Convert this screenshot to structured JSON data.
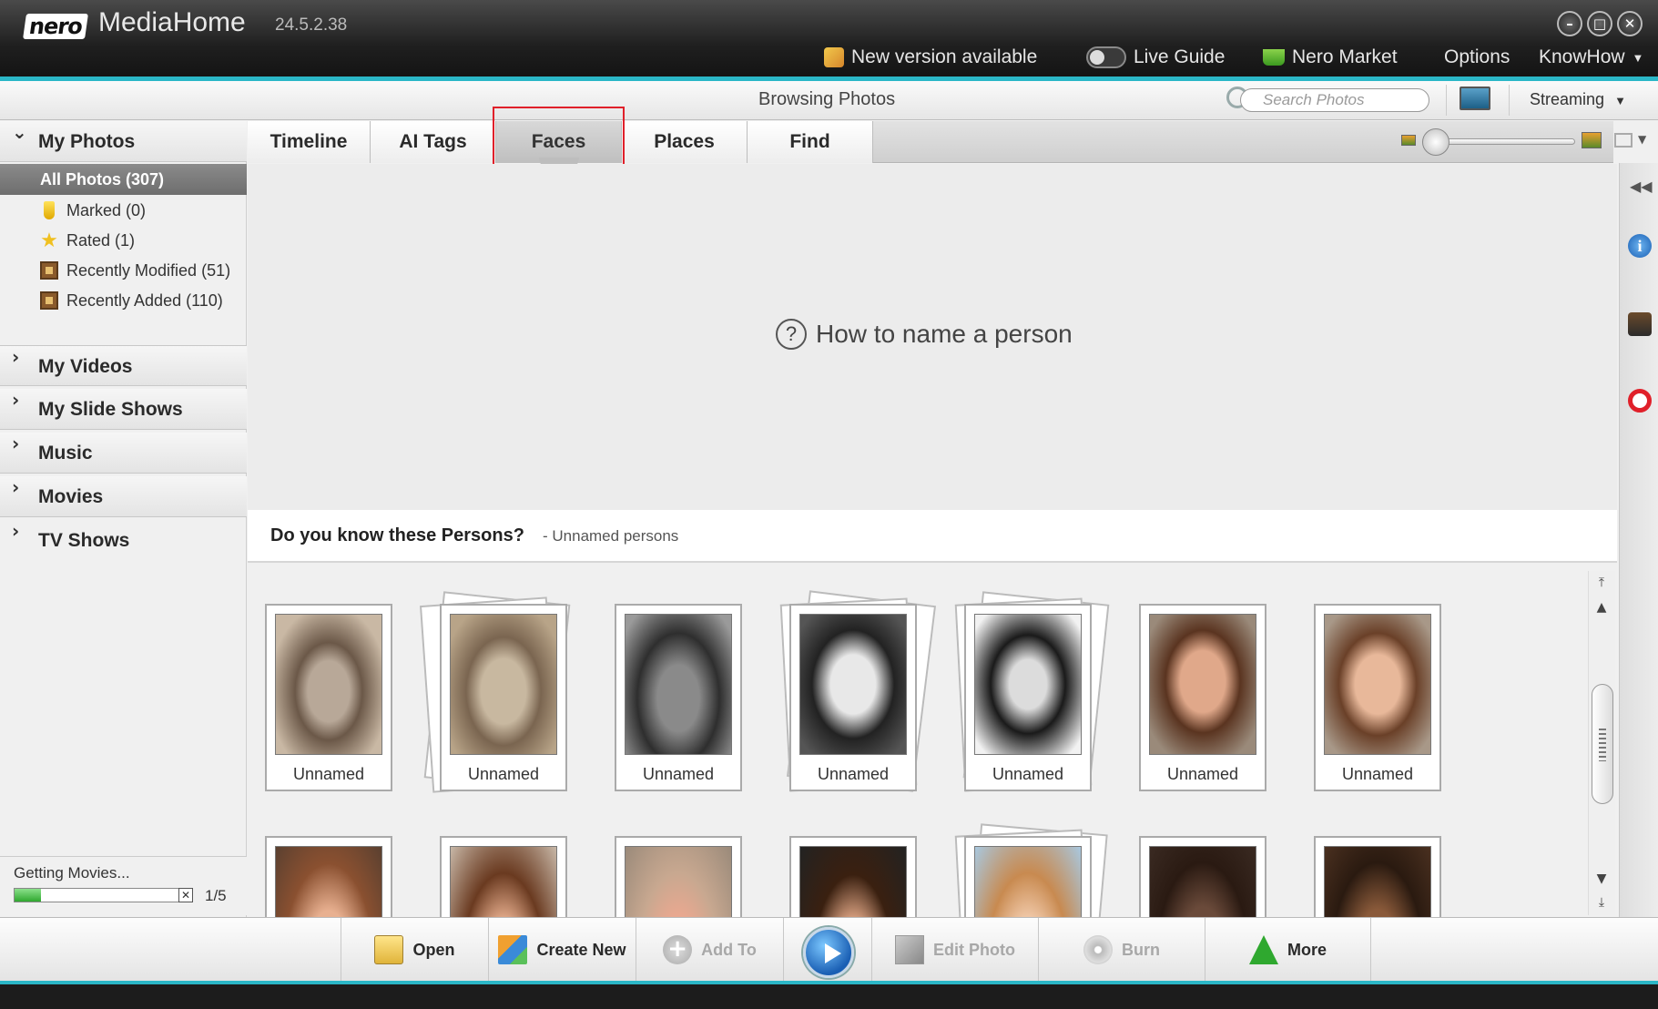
{
  "app": {
    "logo": "nero",
    "title": "MediaHome",
    "version": "24.5.2.38"
  },
  "window_buttons": {
    "minimize": "–",
    "maximize": "□",
    "close": "✕"
  },
  "topmenu": {
    "new_version": "New version available",
    "live_guide": "Live Guide",
    "nero_market": "Nero Market",
    "options": "Options",
    "knowhow": "KnowHow"
  },
  "subheader": {
    "browsing": "Browsing Photos",
    "search_placeholder": "Search Photos",
    "streaming": "Streaming"
  },
  "sidebar": {
    "my_photos": "My Photos",
    "all_photos": "All Photos (307)",
    "items": [
      {
        "label": "Marked (0)",
        "icon": "marked-icon"
      },
      {
        "label": "Rated (1)",
        "icon": "star-icon"
      },
      {
        "label": "Recently Modified (51)",
        "icon": "photo-frame-icon"
      },
      {
        "label": "Recently Added (110)",
        "icon": "photo-frame-icon"
      }
    ],
    "sections": [
      "My Videos",
      "My Slide Shows",
      "Music",
      "Movies",
      "TV Shows"
    ],
    "status": {
      "text": "Getting Movies...",
      "count": "1/5",
      "progress": 0.15
    }
  },
  "tabs": [
    "Timeline",
    "AI Tags",
    "Faces",
    "Places",
    "Find"
  ],
  "active_tab": "Faces",
  "hint": "How to name a person",
  "persons": {
    "title": "Do you know these Persons?",
    "subtitle": "- Unnamed persons",
    "row1": [
      "Unnamed",
      "Unnamed",
      "Unnamed",
      "Unnamed",
      "Unnamed",
      "Unnamed",
      "Unnamed"
    ]
  },
  "toolbar": {
    "open": "Open",
    "create_new": "Create New",
    "add_to": "Add To",
    "edit_photo": "Edit Photo",
    "burn": "Burn",
    "more": "More"
  },
  "colors": {
    "accent": "#2bb7c7",
    "highlight": "#e0202a",
    "title_bg": "#1f1f1f"
  }
}
